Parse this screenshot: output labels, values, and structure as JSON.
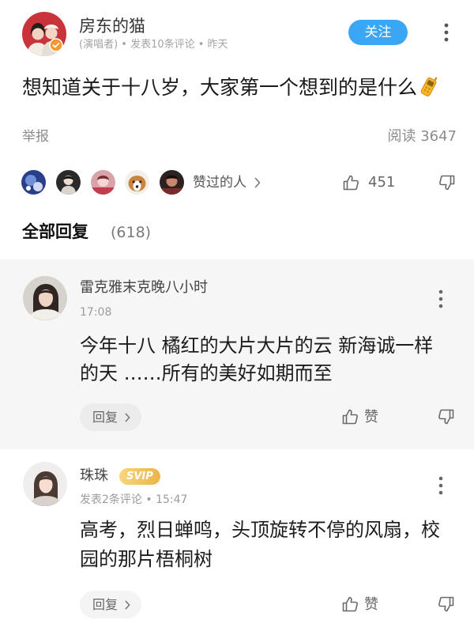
{
  "post": {
    "author_name": "房东的猫",
    "author_meta": "(演唱者) • 发表10条评论 • 昨天",
    "follow_label": "关注",
    "content": "想知道关于十八岁，大家第一个想到的是什么",
    "report_label": "举报",
    "read_count": "阅读 3647",
    "likers_label": "赞过的人",
    "like_count": "451"
  },
  "replies": {
    "header": "全部回复",
    "count": "(618)",
    "items": [
      {
        "name": "雷克雅末克晚八小时",
        "meta": "17:08",
        "content_lines": [
          "今年十八 橘红的大片大片的云 新海诚一样",
          "的天 ……所有的美好如期而至"
        ],
        "reply_label": "回复",
        "like_label": "赞"
      },
      {
        "name": "珠珠",
        "badge": "SVIP",
        "meta": "发表2条评论 • 15:47",
        "content_lines": [
          "高考，烈日蝉鸣，头顶旋转不停的风扇，校",
          "园的那片梧桐树"
        ],
        "reply_label": "回复",
        "like_label": "赞"
      }
    ]
  },
  "icons": {
    "more": "more-vertical-icon",
    "like": "thumbs-up-icon",
    "dislike": "thumbs-down-icon",
    "chevron": "chevron-right-icon",
    "content_emoji": "mobile-phone-emoji-icon",
    "author_badge": "verified-badge-icon"
  },
  "colors": {
    "accent": "#3aa6f4",
    "svip_badge": "#f0c25a",
    "highlight_bg": "#f6f6f6",
    "text_secondary": "#9b9b9b"
  }
}
